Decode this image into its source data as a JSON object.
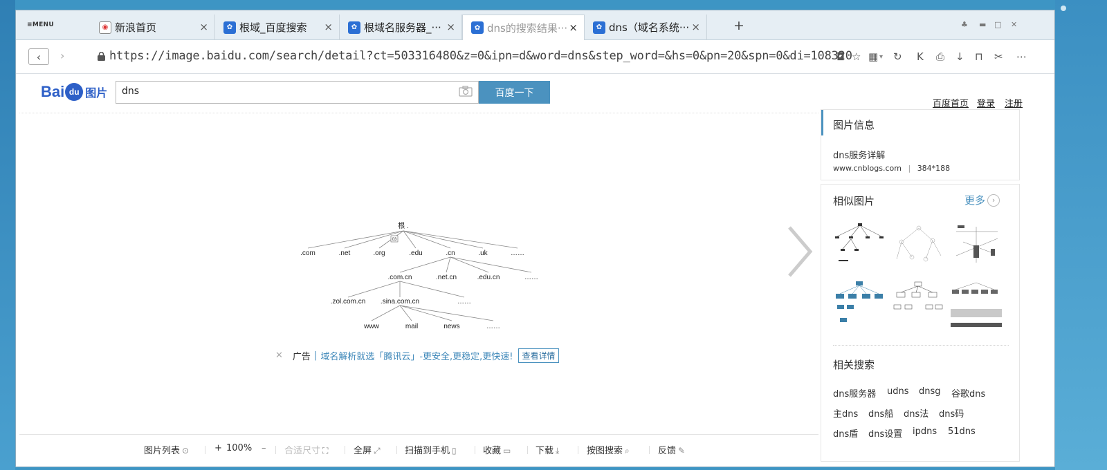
{
  "browser": {
    "menu_label": "≡MENU",
    "tabs": [
      {
        "label": "新浪首页",
        "icon": "weibo-icon",
        "active": false
      },
      {
        "label": "根域_百度搜索",
        "icon": "baidu-paw-icon",
        "active": false
      },
      {
        "label": "根域名服务器_···",
        "icon": "baidu-paw-icon",
        "active": false
      },
      {
        "label": "dns的搜索结果···",
        "icon": "baidu-paw-icon",
        "active": true
      },
      {
        "label": "dns（域名系统···",
        "icon": "baidu-paw-icon",
        "active": false
      }
    ],
    "url": "https://image.baidu.com/search/detail?ct=503316480&z=0&ipn=d&word=dns&step_word=&hs=0&pn=20&spn=0&di=108320"
  },
  "baidu": {
    "logo_text": "Bai",
    "logo_du": "du",
    "logo_pic": "图片",
    "search_value": "dns",
    "search_button": "百度一下",
    "links": [
      "百度首页",
      "登录",
      "注册"
    ]
  },
  "diagram": {
    "root": "根 .",
    "marker": "03",
    "level1": [
      ".com",
      ".net",
      ".org",
      ".edu",
      ".cn",
      ".uk",
      "……"
    ],
    "level2": [
      ".com.cn",
      ".net.cn",
      ".edu.cn",
      "……"
    ],
    "level3": [
      ".zol.com.cn",
      ".sina.com.cn",
      "……"
    ],
    "level4": [
      "www",
      "mail",
      "news",
      "……"
    ]
  },
  "ad": {
    "label": "广告",
    "sep": "|",
    "text": "域名解析就选「腾讯云」-更安全,更稳定,更快速!",
    "button": "查看详情"
  },
  "sidebar": {
    "info_title": "图片信息",
    "image_title": "dns服务详解",
    "source": "www.cnblogs.com",
    "divider": "|",
    "dimensions": "384*188",
    "similar_title": "相似图片",
    "more": "更多",
    "related_title": "相关搜索",
    "related": [
      [
        "dns服务器",
        "udns",
        "dnsg",
        "谷歌dns"
      ],
      [
        "主dns",
        "dns船",
        "dns法",
        "dns码"
      ],
      [
        "dns盾",
        "dns设置",
        "ipdns",
        "51dns"
      ]
    ]
  },
  "toolbar": {
    "list": "图片列表",
    "zoom_in": "+",
    "zoom": "100%",
    "zoom_out": "–",
    "fit": "合适尺寸",
    "fullscreen": "全屏",
    "scan": "扫描到手机",
    "favorite": "收藏",
    "download": "下载",
    "search_by_image": "按图搜索",
    "feedback": "反馈"
  },
  "colors": {
    "accent": "#4b92bf",
    "link": "#3b86b8",
    "desktop": "#3d95c4"
  }
}
